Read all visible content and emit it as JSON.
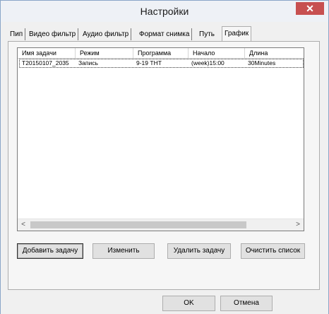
{
  "window": {
    "title": "Настройки",
    "close_glyph": "✕"
  },
  "tabs": [
    {
      "label": "Пип"
    },
    {
      "label": "Видео фильтр"
    },
    {
      "label": "Аудио фильтр"
    },
    {
      "label": "Формат снимка"
    },
    {
      "label": "Путь"
    },
    {
      "label": "График"
    }
  ],
  "table": {
    "columns": [
      "Имя задачи",
      "Режим",
      "Программа",
      "Начало",
      "Длина"
    ],
    "rows": [
      [
        "T20150107_2035",
        "Запись",
        "9-19 ТНТ",
        "(week)15:00",
        "30Minutes"
      ]
    ]
  },
  "scroll": {
    "left_glyph": "<",
    "right_glyph": ">"
  },
  "buttons": {
    "add": "Добавить задачу",
    "edit": "Изменить",
    "delete": "Удалить задачу",
    "clear": "Очистить список"
  },
  "footer": {
    "ok": "OK",
    "cancel": "Отмена"
  }
}
